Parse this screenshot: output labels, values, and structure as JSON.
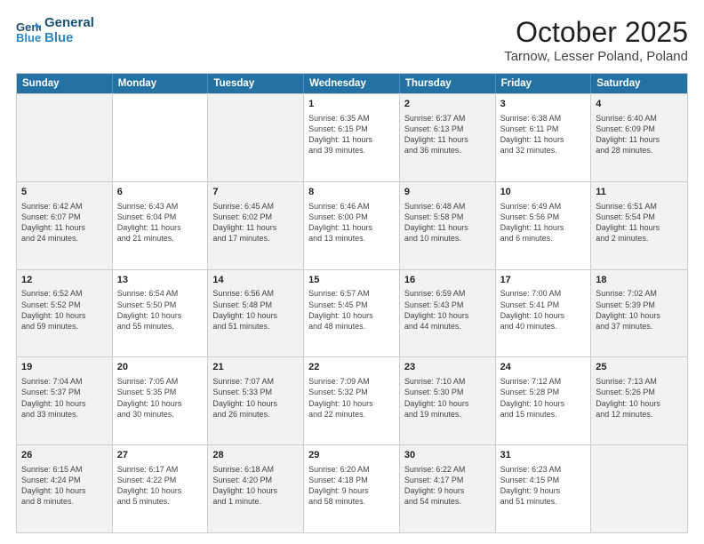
{
  "header": {
    "logo_line1": "General",
    "logo_line2": "Blue",
    "month": "October 2025",
    "location": "Tarnow, Lesser Poland, Poland"
  },
  "days_of_week": [
    "Sunday",
    "Monday",
    "Tuesday",
    "Wednesday",
    "Thursday",
    "Friday",
    "Saturday"
  ],
  "rows": [
    [
      {
        "day": "",
        "info": "",
        "shaded": true
      },
      {
        "day": "",
        "info": "",
        "shaded": false
      },
      {
        "day": "",
        "info": "",
        "shaded": true
      },
      {
        "day": "1",
        "info": "Sunrise: 6:35 AM\nSunset: 6:15 PM\nDaylight: 11 hours\nand 39 minutes.",
        "shaded": false
      },
      {
        "day": "2",
        "info": "Sunrise: 6:37 AM\nSunset: 6:13 PM\nDaylight: 11 hours\nand 36 minutes.",
        "shaded": true
      },
      {
        "day": "3",
        "info": "Sunrise: 6:38 AM\nSunset: 6:11 PM\nDaylight: 11 hours\nand 32 minutes.",
        "shaded": false
      },
      {
        "day": "4",
        "info": "Sunrise: 6:40 AM\nSunset: 6:09 PM\nDaylight: 11 hours\nand 28 minutes.",
        "shaded": true
      }
    ],
    [
      {
        "day": "5",
        "info": "Sunrise: 6:42 AM\nSunset: 6:07 PM\nDaylight: 11 hours\nand 24 minutes.",
        "shaded": true
      },
      {
        "day": "6",
        "info": "Sunrise: 6:43 AM\nSunset: 6:04 PM\nDaylight: 11 hours\nand 21 minutes.",
        "shaded": false
      },
      {
        "day": "7",
        "info": "Sunrise: 6:45 AM\nSunset: 6:02 PM\nDaylight: 11 hours\nand 17 minutes.",
        "shaded": true
      },
      {
        "day": "8",
        "info": "Sunrise: 6:46 AM\nSunset: 6:00 PM\nDaylight: 11 hours\nand 13 minutes.",
        "shaded": false
      },
      {
        "day": "9",
        "info": "Sunrise: 6:48 AM\nSunset: 5:58 PM\nDaylight: 11 hours\nand 10 minutes.",
        "shaded": true
      },
      {
        "day": "10",
        "info": "Sunrise: 6:49 AM\nSunset: 5:56 PM\nDaylight: 11 hours\nand 6 minutes.",
        "shaded": false
      },
      {
        "day": "11",
        "info": "Sunrise: 6:51 AM\nSunset: 5:54 PM\nDaylight: 11 hours\nand 2 minutes.",
        "shaded": true
      }
    ],
    [
      {
        "day": "12",
        "info": "Sunrise: 6:52 AM\nSunset: 5:52 PM\nDaylight: 10 hours\nand 59 minutes.",
        "shaded": true
      },
      {
        "day": "13",
        "info": "Sunrise: 6:54 AM\nSunset: 5:50 PM\nDaylight: 10 hours\nand 55 minutes.",
        "shaded": false
      },
      {
        "day": "14",
        "info": "Sunrise: 6:56 AM\nSunset: 5:48 PM\nDaylight: 10 hours\nand 51 minutes.",
        "shaded": true
      },
      {
        "day": "15",
        "info": "Sunrise: 6:57 AM\nSunset: 5:45 PM\nDaylight: 10 hours\nand 48 minutes.",
        "shaded": false
      },
      {
        "day": "16",
        "info": "Sunrise: 6:59 AM\nSunset: 5:43 PM\nDaylight: 10 hours\nand 44 minutes.",
        "shaded": true
      },
      {
        "day": "17",
        "info": "Sunrise: 7:00 AM\nSunset: 5:41 PM\nDaylight: 10 hours\nand 40 minutes.",
        "shaded": false
      },
      {
        "day": "18",
        "info": "Sunrise: 7:02 AM\nSunset: 5:39 PM\nDaylight: 10 hours\nand 37 minutes.",
        "shaded": true
      }
    ],
    [
      {
        "day": "19",
        "info": "Sunrise: 7:04 AM\nSunset: 5:37 PM\nDaylight: 10 hours\nand 33 minutes.",
        "shaded": true
      },
      {
        "day": "20",
        "info": "Sunrise: 7:05 AM\nSunset: 5:35 PM\nDaylight: 10 hours\nand 30 minutes.",
        "shaded": false
      },
      {
        "day": "21",
        "info": "Sunrise: 7:07 AM\nSunset: 5:33 PM\nDaylight: 10 hours\nand 26 minutes.",
        "shaded": true
      },
      {
        "day": "22",
        "info": "Sunrise: 7:09 AM\nSunset: 5:32 PM\nDaylight: 10 hours\nand 22 minutes.",
        "shaded": false
      },
      {
        "day": "23",
        "info": "Sunrise: 7:10 AM\nSunset: 5:30 PM\nDaylight: 10 hours\nand 19 minutes.",
        "shaded": true
      },
      {
        "day": "24",
        "info": "Sunrise: 7:12 AM\nSunset: 5:28 PM\nDaylight: 10 hours\nand 15 minutes.",
        "shaded": false
      },
      {
        "day": "25",
        "info": "Sunrise: 7:13 AM\nSunset: 5:26 PM\nDaylight: 10 hours\nand 12 minutes.",
        "shaded": true
      }
    ],
    [
      {
        "day": "26",
        "info": "Sunrise: 6:15 AM\nSunset: 4:24 PM\nDaylight: 10 hours\nand 8 minutes.",
        "shaded": true
      },
      {
        "day": "27",
        "info": "Sunrise: 6:17 AM\nSunset: 4:22 PM\nDaylight: 10 hours\nand 5 minutes.",
        "shaded": false
      },
      {
        "day": "28",
        "info": "Sunrise: 6:18 AM\nSunset: 4:20 PM\nDaylight: 10 hours\nand 1 minute.",
        "shaded": true
      },
      {
        "day": "29",
        "info": "Sunrise: 6:20 AM\nSunset: 4:18 PM\nDaylight: 9 hours\nand 58 minutes.",
        "shaded": false
      },
      {
        "day": "30",
        "info": "Sunrise: 6:22 AM\nSunset: 4:17 PM\nDaylight: 9 hours\nand 54 minutes.",
        "shaded": true
      },
      {
        "day": "31",
        "info": "Sunrise: 6:23 AM\nSunset: 4:15 PM\nDaylight: 9 hours\nand 51 minutes.",
        "shaded": false
      },
      {
        "day": "",
        "info": "",
        "shaded": true
      }
    ]
  ]
}
